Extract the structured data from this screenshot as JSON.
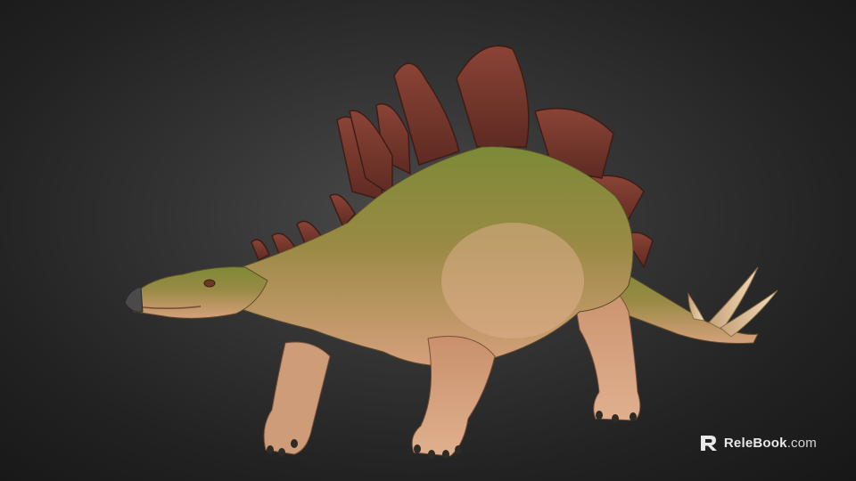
{
  "scene": {
    "subject_icon": "stegosaurus-model",
    "colors": {
      "background_center": "#4a4a4a",
      "background_edge": "#171717",
      "body_green": "#7a8a3a",
      "belly_peach": "#d9a27c",
      "plates_red": "#7a3a2c"
    }
  },
  "watermark": {
    "logo_icon": "relebook-logo-icon",
    "brand": "ReleBook",
    "tld": ".com",
    "color": "#e8e8e8"
  }
}
